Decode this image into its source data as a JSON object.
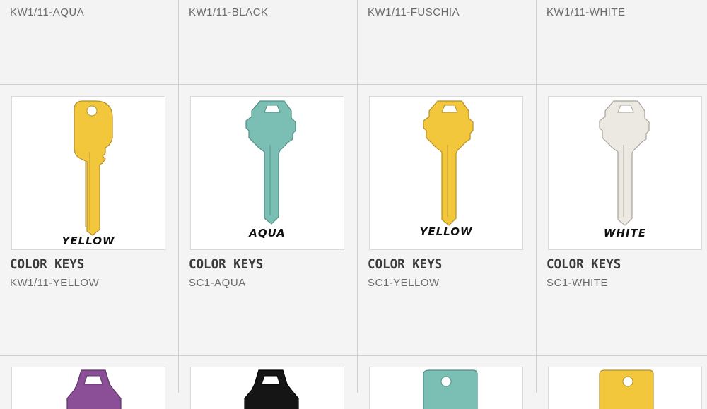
{
  "top_row": {
    "skus": [
      "KW1/11-AQUA",
      "KW1/11-BLACK",
      "KW1/11-FUSCHIA",
      "KW1/11-WHITE"
    ]
  },
  "products": [
    {
      "title": "COLOR KEYS",
      "sku": "KW1/11-YELLOW",
      "label": "YELLOW",
      "color": "#f2c73b",
      "icon": "kw1-key-icon"
    },
    {
      "title": "COLOR KEYS",
      "sku": "SC1-AQUA",
      "label": "AQUA",
      "color": "#7bbfb4",
      "icon": "sc1-key-icon"
    },
    {
      "title": "COLOR KEYS",
      "sku": "SC1-YELLOW",
      "label": "YELLOW",
      "color": "#f2c73b",
      "icon": "sc1-key-icon"
    },
    {
      "title": "COLOR KEYS",
      "sku": "SC1-WHITE",
      "label": "WHITE",
      "color": "#ece8e2",
      "icon": "sc1-key-icon"
    }
  ],
  "bottom_row": {
    "colors": [
      "#8a4f96",
      "#151515",
      "#7bbfb4",
      "#f2c73b"
    ]
  }
}
